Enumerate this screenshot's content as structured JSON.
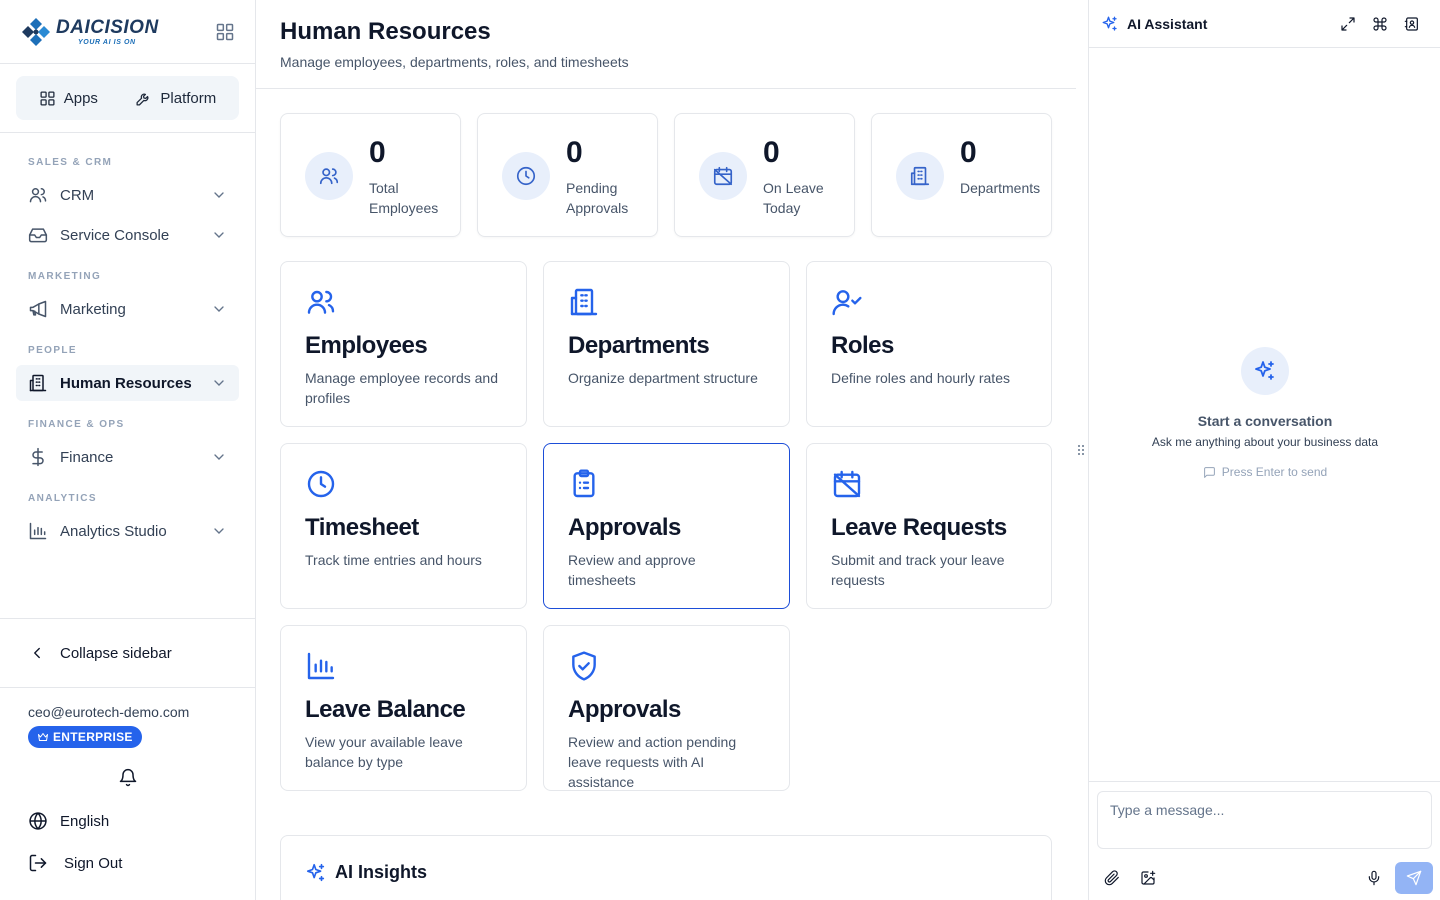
{
  "brand": {
    "name": "DAICISION",
    "tagline": "YOUR AI IS ON"
  },
  "switcher": {
    "apps_label": "Apps",
    "platform_label": "Platform"
  },
  "sidebar": {
    "sections": [
      {
        "title": "SALES & CRM",
        "items": [
          {
            "label": "CRM",
            "icon": "users-icon"
          },
          {
            "label": "Service Console",
            "icon": "inbox-icon"
          }
        ]
      },
      {
        "title": "MARKETING",
        "items": [
          {
            "label": "Marketing",
            "icon": "megaphone-icon"
          }
        ]
      },
      {
        "title": "PEOPLE",
        "items": [
          {
            "label": "Human Resources",
            "icon": "building-icon",
            "active": true
          }
        ]
      },
      {
        "title": "FINANCE & OPS",
        "items": [
          {
            "label": "Finance",
            "icon": "dollar-icon"
          }
        ]
      },
      {
        "title": "ANALYTICS",
        "items": [
          {
            "label": "Analytics Studio",
            "icon": "bar-chart-icon"
          }
        ]
      }
    ],
    "collapse_label": "Collapse sidebar",
    "user_email": "ceo@eurotech-demo.com",
    "plan_badge": "ENTERPRISE",
    "language": "English",
    "sign_out": "Sign Out"
  },
  "header": {
    "title": "Human Resources",
    "subtitle": "Manage employees, departments, roles, and timesheets"
  },
  "stats": [
    {
      "value": "0",
      "label": "Total Employees",
      "icon": "users-icon"
    },
    {
      "value": "0",
      "label": "Pending Approvals",
      "icon": "clock-icon"
    },
    {
      "value": "0",
      "label": "On Leave Today",
      "icon": "calendar-off-icon"
    },
    {
      "value": "0",
      "label": "Departments",
      "icon": "building-icon"
    }
  ],
  "modules": [
    {
      "title": "Employees",
      "description": "Manage employee records and profiles",
      "icon": "users-icon"
    },
    {
      "title": "Departments",
      "description": "Organize department structure",
      "icon": "building-icon"
    },
    {
      "title": "Roles",
      "description": "Define roles and hourly rates",
      "icon": "user-check-icon"
    },
    {
      "title": "Timesheet",
      "description": "Track time entries and hours",
      "icon": "clock-icon"
    },
    {
      "title": "Approvals",
      "description": "Review and approve timesheets",
      "icon": "clipboard-list-icon",
      "selected": true
    },
    {
      "title": "Leave Requests",
      "description": "Submit and track your leave requests",
      "icon": "calendar-off-icon"
    },
    {
      "title": "Leave Balance",
      "description": "View your available leave balance by type",
      "icon": "bar-chart-icon"
    },
    {
      "title": "Approvals",
      "description": "Review and action pending leave requests with AI assistance",
      "icon": "shield-check-icon"
    }
  ],
  "insights": {
    "title": "AI Insights"
  },
  "ai": {
    "title": "AI Assistant",
    "empty_title": "Start a conversation",
    "empty_subtitle": "Ask me anything about your business data",
    "hint": "Press Enter to send",
    "input_placeholder": "Type a message..."
  },
  "colors": {
    "accent": "#2563eb",
    "icon_bg": "#e8effb",
    "send_disabled": "#93b4f5",
    "badge": "#2563eb"
  }
}
